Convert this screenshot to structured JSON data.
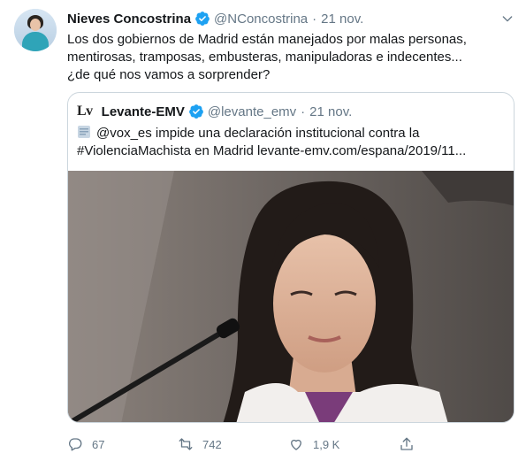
{
  "tweet": {
    "author_name": "Nieves Concostrina",
    "author_handle": "@NConcostrina",
    "separator": "·",
    "date": "21 nov.",
    "text": "Los dos gobiernos de Madrid están manejados por malas personas, mentirosas, tramposas, embusteras, manipuladoras e indecentes... ¿de qué nos vamos a sorprender?"
  },
  "quote": {
    "logo": "Lv",
    "author_name": "Levante-EMV",
    "author_handle": "@levante_emv",
    "separator": "·",
    "date": "21 nov.",
    "text": "@vox_es impide una declaración institucional contra la #ViolenciaMachista en Madrid levante-emv.com/espana/2019/11..."
  },
  "actions": {
    "replies": "67",
    "retweets": "742",
    "likes": "1,9 K"
  },
  "colors": {
    "verified": "#1da1f2",
    "secondary_text": "#657786",
    "border": "#ccd6dd"
  },
  "icons": {
    "verified": "verified-badge-icon",
    "more": "chevron-down-icon",
    "reply": "reply-icon",
    "retweet": "retweet-icon",
    "like": "heart-icon",
    "share": "share-icon",
    "link_preview": "document-icon"
  }
}
